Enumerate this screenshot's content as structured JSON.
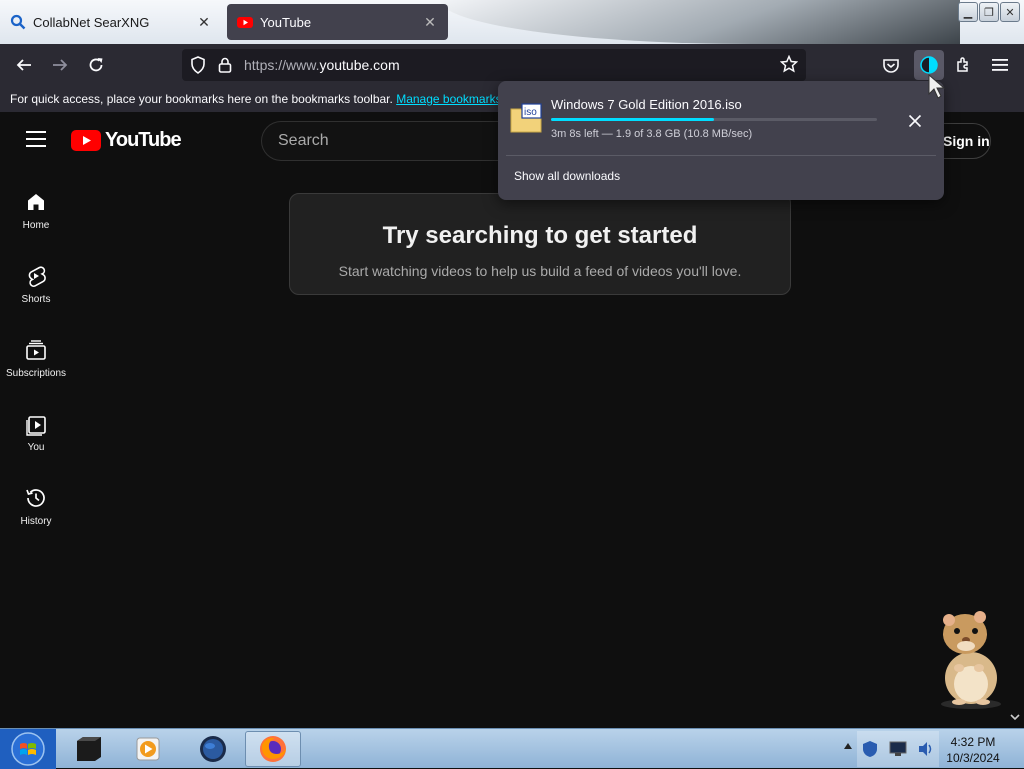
{
  "browser": {
    "tabs": [
      {
        "title": "CollabNet SearXNG",
        "favicon": "search-icon",
        "active": false
      },
      {
        "title": "YouTube",
        "favicon": "youtube-icon",
        "active": true
      }
    ],
    "url_prefix": "https://www.",
    "url_domain": "youtube.com",
    "bookmarks_bar": {
      "message": "For quick access, place your bookmarks here on the bookmarks toolbar.",
      "link": "Manage bookmarks..."
    }
  },
  "youtube": {
    "logo_text": "YouTube",
    "search_placeholder": "Search",
    "signin_label": "Sign in",
    "sidebar": [
      {
        "label": "Home",
        "icon": "home-icon"
      },
      {
        "label": "Shorts",
        "icon": "shorts-icon"
      },
      {
        "label": "Subscriptions",
        "icon": "subscriptions-icon"
      },
      {
        "label": "You",
        "icon": "you-icon"
      },
      {
        "label": "History",
        "icon": "history-icon"
      }
    ],
    "empty_state": {
      "title": "Try searching to get started",
      "subtitle": "Start watching videos to help us build a feed of videos you'll love."
    }
  },
  "downloads_panel": {
    "file_name": "Windows 7 Gold Edition 2016.iso",
    "status": "3m 8s left — 1.9 of 3.8 GB (10.8 MB/sec)",
    "progress_fraction": 0.5,
    "show_all_label": "Show all downloads",
    "accent_color": "#00ddff"
  },
  "taskbar": {
    "time": "4:32 PM",
    "date": "10/3/2024"
  }
}
